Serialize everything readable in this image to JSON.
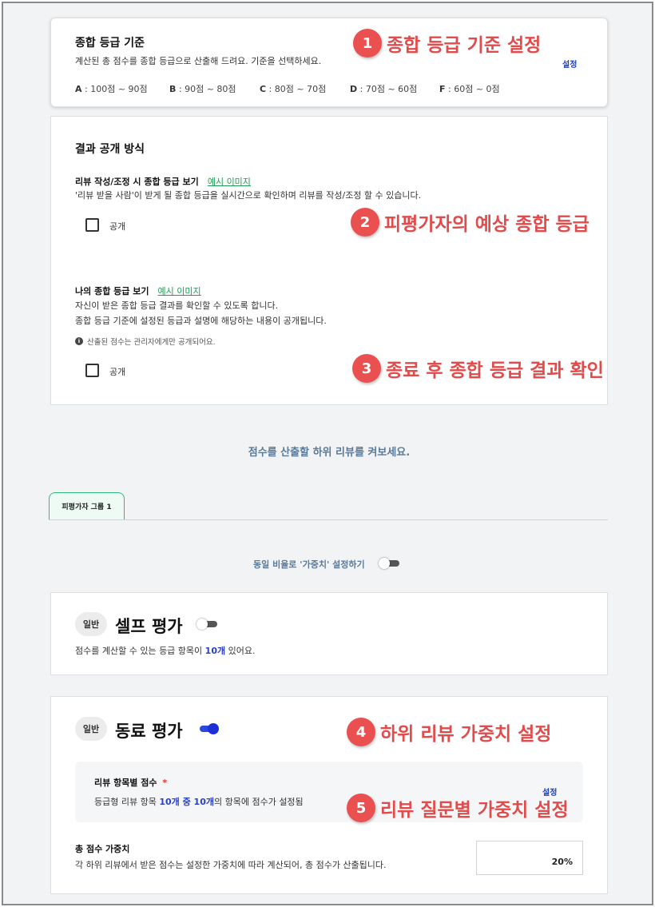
{
  "grade_standard": {
    "title": "종합 등급 기준",
    "description": "계산된 총 점수를 종합 등급으로 산출해 드려요. 기준을 선택하세요.",
    "set_link": "설정",
    "grades": [
      {
        "letter": "A",
        "range": " : 100점 ~ 90점"
      },
      {
        "letter": "B",
        "range": " : 90점 ~ 80점"
      },
      {
        "letter": "C",
        "range": " : 80점 ~ 70점"
      },
      {
        "letter": "D",
        "range": " : 70점 ~ 60점"
      },
      {
        "letter": "F",
        "range": " : 60점 ~ 0점"
      }
    ]
  },
  "result_disclosure": {
    "title": "결과 공개 방식",
    "review_section": {
      "label": "리뷰 작성/조정 시 종합 등급 보기",
      "example_link": "예시 이미지",
      "description": "'리뷰 받을 사람'이 받게 될 종합 등급을 실시간으로 확인하며 리뷰를 작성/조정 할 수 있습니다.",
      "checkbox_label": "공개"
    },
    "my_grade_section": {
      "label": "나의 종합 등급 보기",
      "example_link": "예시 이미지",
      "description_1": "자신이 받은 종합 등급 결과를 확인할 수 있도록 합니다.",
      "description_2": "종합 등급 기준에 설정된 등급과 설명에 해당하는 내용이 공개됩니다.",
      "info_note": "산출된 점수는 관리자에게만 공개되어요.",
      "checkbox_label": "공개"
    }
  },
  "sub_review_prompt": "점수를 산출할 하위 리뷰를 켜보세요.",
  "tabs": [
    {
      "label": "피평가자 그룹 1",
      "active": true
    }
  ],
  "equal_weight": {
    "label": "동일 비율로 '가중치' 설정하기",
    "enabled": false
  },
  "self_review": {
    "badge": "일반",
    "title": "셀프 평가",
    "enabled": false,
    "desc_prefix": "점수를 계산할 수 있는 등급 항목이 ",
    "count": "10개",
    "desc_suffix": " 있어요."
  },
  "peer_review": {
    "badge": "일반",
    "title": "동료 평가",
    "enabled": true,
    "item_score": {
      "label": "리뷰 항목별 점수",
      "required_mark": "*",
      "set_link": "설정",
      "desc_prefix": "등급형 리뷰 항목 ",
      "desc_highlight": "10개 중 10개",
      "desc_suffix": "의 항목에 점수가 설정됨"
    },
    "total_weight": {
      "label": "총 점수 가중치",
      "description": "각 하위 리뷰에서 받은 점수는 설정한 가중치에 따라 계산되어, 총 점수가 산출됩니다.",
      "value": "20%"
    }
  },
  "annotations": [
    {
      "num": "1",
      "text": "종합 등급 기준 설정"
    },
    {
      "num": "2",
      "text": "피평가자의 예상 종합 등급"
    },
    {
      "num": "3",
      "text": "종료 후 종합 등급 결과 확인"
    },
    {
      "num": "4",
      "text": "하위 리뷰 가중치 설정"
    },
    {
      "num": "5",
      "text": "리뷰 질문별 가중치 설정"
    }
  ],
  "colors": {
    "annotation_red": "#ea5050",
    "link_green": "#1f9d55",
    "link_blue": "#1f3fb5",
    "toggle_on": "#1d2fd6",
    "tab_border": "#2fb97a"
  }
}
